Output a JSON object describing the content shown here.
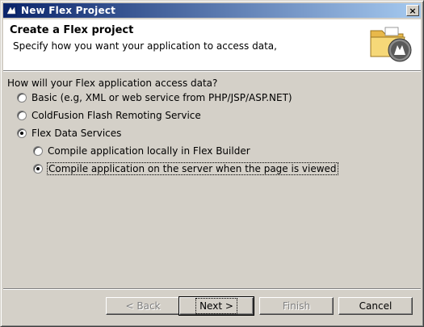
{
  "window": {
    "title": "New Flex Project",
    "close_glyph": "×"
  },
  "banner": {
    "title": "Create a Flex project",
    "description": "Specify how you want your application to access data,"
  },
  "form": {
    "question": "How will your Flex application access data?",
    "options": [
      {
        "label": "Basic (e.g, XML or web service from PHP/JSP/ASP.NET)",
        "selected": false
      },
      {
        "label": "ColdFusion Flash Remoting Service",
        "selected": false
      },
      {
        "label": "Flex Data Services",
        "selected": true
      }
    ],
    "sub_options": [
      {
        "label": "Compile application locally in Flex Builder",
        "selected": false
      },
      {
        "label": "Compile application on the server when the page is viewed",
        "selected": true
      }
    ]
  },
  "buttons": {
    "back": "< Back",
    "next": "Next >",
    "finish": "Finish",
    "cancel": "Cancel"
  },
  "colors": {
    "titlebar_start": "#0a246a",
    "titlebar_end": "#a6caf0",
    "dialog_bg": "#d4d0c8",
    "banner_bg": "#ffffff"
  },
  "icons": {
    "title": "flex-logo-icon",
    "banner": "flex-project-folder-icon"
  }
}
